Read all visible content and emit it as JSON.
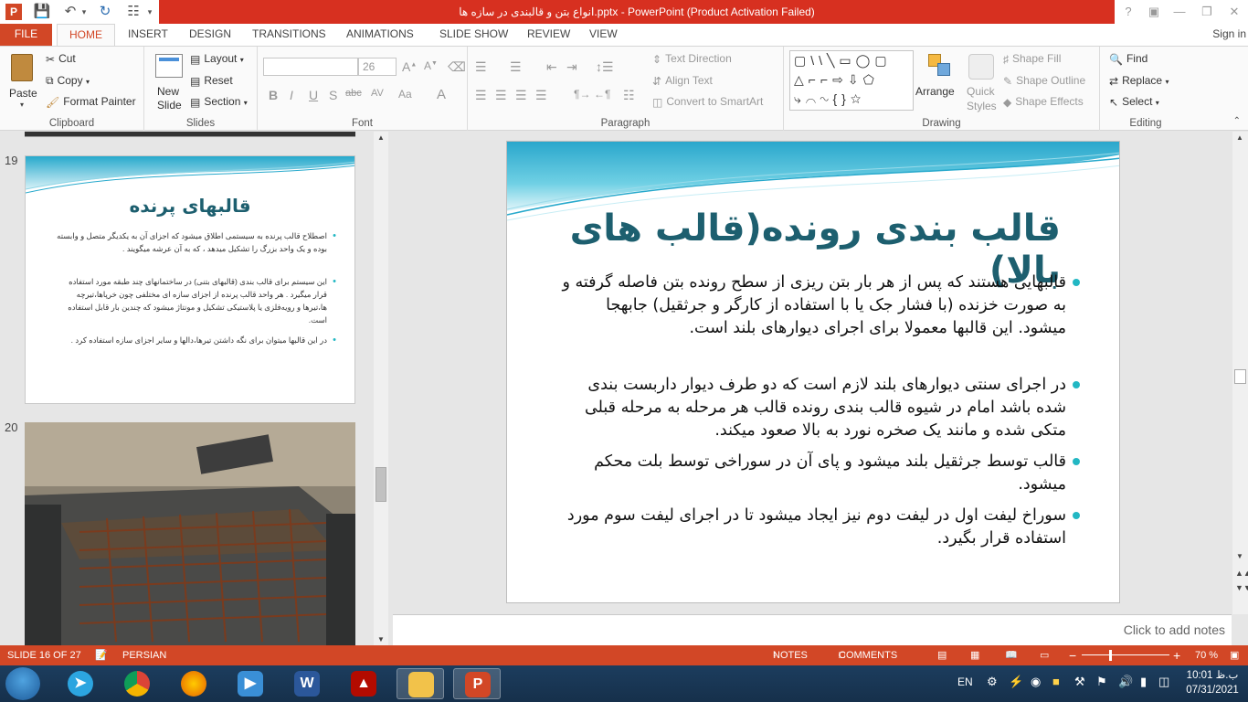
{
  "window": {
    "title": "انواع بتن و قالبندی در سازه ها.pptx  -  PowerPoint (Product Activation Failed)",
    "help": "?",
    "minimize": "—",
    "restore": "❐",
    "close": "✕"
  },
  "tabs": [
    "FILE",
    "HOME",
    "INSERT",
    "DESIGN",
    "TRANSITIONS",
    "ANIMATIONS",
    "SLIDE SHOW",
    "REVIEW",
    "VIEW"
  ],
  "signin": "Sign in",
  "ribbon": {
    "clipboard": {
      "label": "Clipboard",
      "paste": "Paste",
      "cut": "Cut",
      "copy": "Copy",
      "format_painter": "Format Painter"
    },
    "slides": {
      "label": "Slides",
      "new_slide_1": "New",
      "new_slide_2": "Slide",
      "layout": "Layout",
      "reset": "Reset",
      "section": "Section"
    },
    "font": {
      "label": "Font",
      "font_name": "",
      "font_size": "26"
    },
    "paragraph": {
      "label": "Paragraph",
      "text_direction": "Text Direction",
      "align_text": "Align Text",
      "convert_smartart": "Convert to SmartArt"
    },
    "drawing": {
      "label": "Drawing",
      "arrange": "Arrange",
      "quick_styles_1": "Quick",
      "quick_styles_2": "Styles",
      "shape_fill": "Shape Fill",
      "shape_outline": "Shape Outline",
      "shape_effects": "Shape Effects"
    },
    "editing": {
      "label": "Editing",
      "find": "Find",
      "replace": "Replace",
      "select": "Select"
    }
  },
  "thumbnails": [
    {
      "number": "19",
      "title": "قالبهای پرنده",
      "bullets": [
        "اصطلاح قالب پرنده به سیستمی اطلاق میشود که اجزای  آن به یکدیگر متصل و وابسته بوده و یک واحد بزرگ را تشکیل میدهد ، که به آن عرشه میگویند .",
        "این سیستم برای قالب بندی (قالبهای بتنی) در ساختمانهای چند طبقه مورد استفاده قرار میگیرد . هر واحد قالب پرنده از اجزای سازه ای مختلفی چون خرپاها،تیرچه ها،تیرها و رویه‌فلزی یا پلاستیکی تشکیل و مونتاژ میشود که چندین بار قابل استفاده است.",
        "در این قالبها میتوان برای نگه داشتن تیرها،دالها و سایر اجزای سازه استفاده کرد ."
      ]
    },
    {
      "number": "20"
    }
  ],
  "slide": {
    "title": "قالب بندی رونده(قالب های بالا)",
    "bullets": [
      "قالبهایی هستند که پس از هر بار بتن ریزی از سطح رونده بتن فاصله گرفته و به صورت خزنده (با فشار جک یا با استفاده از کارگر و جرثقیل) جابهجا میشود. این قالبها معمولا برای اجرای دیوارهای بلند است.",
      "در اجرای سنتی دیوارهای بلند لازم است که دو طرف دیوار داربست بندی شده باشد امام در شیوه قالب بندی رونده قالب هر مرحله به مرحله قبلی متکی شده و مانند یک صخره نورد به بالا صعود میکند.",
      "قالب توسط جرثقیل بلند میشود و پای آن در سوراخی توسط بلت محکم میشود.",
      "سوراخ لیفت اول در لیفت دوم  نیز ایجاد میشود تا در اجرای لیفت سوم مورد استفاده قرار بگیرد."
    ]
  },
  "notes_placeholder": "Click to add notes",
  "status": {
    "slide_info": "SLIDE 16 OF 27",
    "language": "PERSIAN",
    "notes": "NOTES",
    "comments": "COMMENTS",
    "zoom": "70 %"
  },
  "taskbar": {
    "language": "EN",
    "time": "10:01 ب.ظ",
    "date": "07/31/2021"
  },
  "colors": {
    "accent": "#D24726",
    "title_red": "#D73020",
    "slide_title": "#1D5F6F",
    "bullet": "#22B7C3"
  }
}
